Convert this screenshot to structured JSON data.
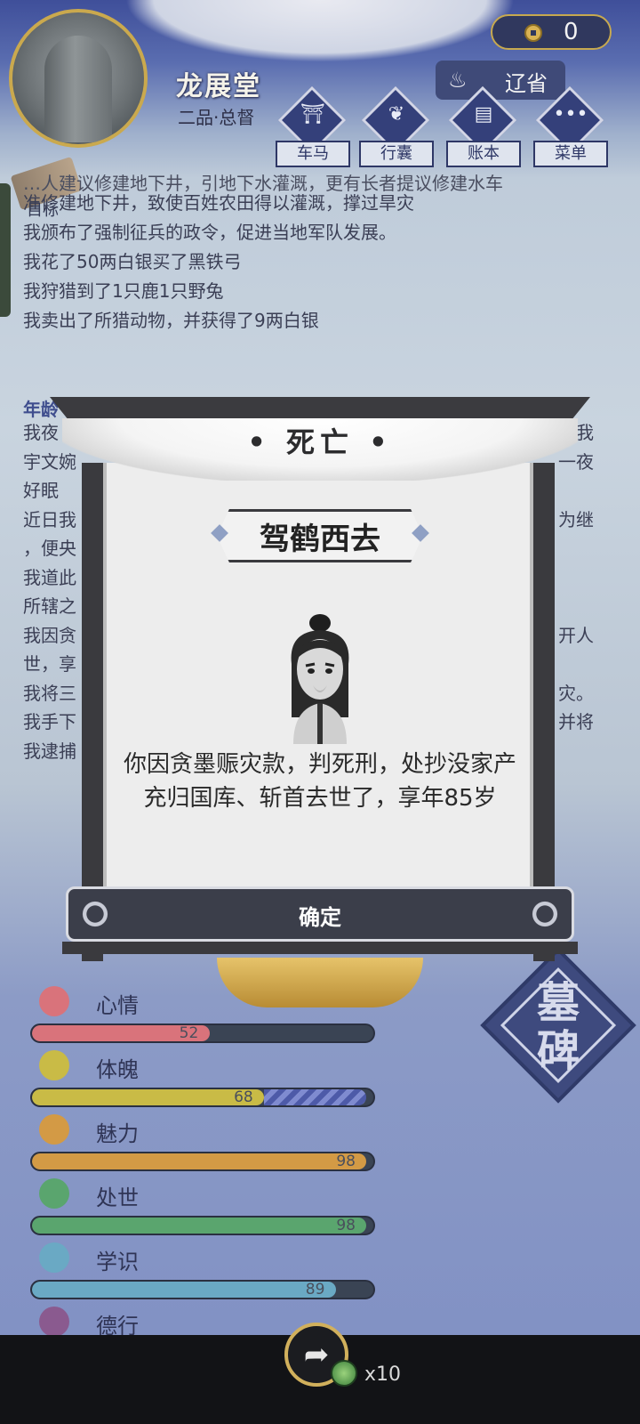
{
  "header": {
    "name": "龙展堂",
    "rank": "二品·总督",
    "currency_value": "0",
    "province_label": "辽省",
    "nav": [
      {
        "label": "车马",
        "icon": "carriage-icon"
      },
      {
        "label": "行囊",
        "icon": "bag-icon"
      },
      {
        "label": "账本",
        "icon": "ledger-icon"
      },
      {
        "label": "菜单",
        "icon": "menu-icon"
      }
    ]
  },
  "goal_label": "目标",
  "log": {
    "lines": [
      "…人建议修建地下井，引地下水灌溉，更有长者提议修建水车",
      "准修建地下井，致使百姓农田得以灌溉，撑过旱灾",
      "我颁布了强制征兵的政令，促进当地军队发展。",
      "我花了50两白银买了黑铁弓",
      "我狩猎到了1只鹿1只野兔",
      "我卖出了所猎动物，并获得了9两白银"
    ],
    "age_heading": "年龄",
    "lines2": [
      {
        "left": "我夜",
        "right": "我"
      },
      {
        "left": "宇文婉",
        "right": "一夜"
      },
      {
        "left": "好眠",
        "right": ""
      },
      {
        "left": "近日我",
        "right": "为继"
      },
      {
        "left": "，便央",
        "right": ""
      },
      {
        "left": "我道此",
        "right": ""
      },
      {
        "left": "所辖之",
        "right": ""
      },
      {
        "left": "我因贪",
        "right": "开人"
      },
      {
        "left": "世，享",
        "right": ""
      },
      {
        "left": "我将三",
        "right": "灾。"
      },
      {
        "left": "我手下",
        "right": "并将"
      },
      {
        "left": "我逮捕",
        "right": ""
      }
    ]
  },
  "modal": {
    "title": "死亡",
    "subtitle": "驾鹤西去",
    "message": "你因贪墨赈灾款，判死刑，处抄没家产充归国库、斩首去世了，享年85岁",
    "confirm_label": "确定"
  },
  "stats": [
    {
      "label": "心情",
      "value": 52,
      "color": "#d9737b",
      "icon": "flower-icon"
    },
    {
      "label": "体魄",
      "value": 68,
      "color": "#c9bb46",
      "icon": "physique-icon",
      "extra": 30
    },
    {
      "label": "魅力",
      "value": 98,
      "color": "#d39a45",
      "icon": "charm-icon"
    },
    {
      "label": "处世",
      "value": 98,
      "color": "#5aa56e",
      "icon": "worldly-icon"
    },
    {
      "label": "学识",
      "value": 89,
      "color": "#6aa9c4",
      "icon": "books-icon"
    },
    {
      "label": "德行",
      "value": null,
      "color": "#8a5a8f",
      "icon": "virtue-icon"
    }
  ],
  "tomb_label": "墓碑",
  "bottom": {
    "token_count": "x10"
  }
}
